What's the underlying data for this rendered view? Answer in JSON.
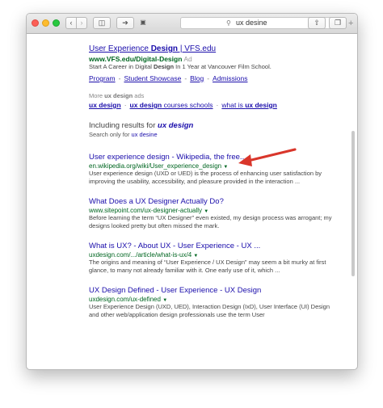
{
  "browser": {
    "address": "ux desine"
  },
  "ad": {
    "title_pre": "User Experience ",
    "title_bold": "Design",
    "title_post": " | VFS.edu",
    "url_pre": "www.VFS.edu/Digital-",
    "url_bold": "Design",
    "ad_tag": "Ad",
    "snippet_pre": "Start A Career in Digital ",
    "snippet_bold": "Design",
    "snippet_post": " In 1 Year at Vancouver Film School.",
    "sitelinks": [
      "Program",
      "Student Showcase",
      "Blog",
      "Admissions"
    ],
    "separator": "-"
  },
  "more_ads": {
    "label_pre": "More ",
    "label_bold": "ux design",
    "label_post": " ads",
    "links": [
      {
        "bold": "ux design",
        "rest": ""
      },
      {
        "bold": "ux design",
        "rest": " courses schools"
      },
      {
        "bold": "ux design",
        "rest": "what is ",
        "order": "rest-first"
      }
    ],
    "sep": "·"
  },
  "spell": {
    "including_pre": "Including results for ",
    "including_term": "ux design",
    "search_only_pre": "Search only for ",
    "search_only_term": "ux desine"
  },
  "results": [
    {
      "title": "User experience design - Wikipedia, the free...",
      "url": "en.wikipedia.org/wiki/User_experience_design",
      "snippet": "User experience design (UXD or UED) is the process of enhancing user satisfaction by improving the usability, accessibility, and pleasure provided in the interaction ..."
    },
    {
      "title": "What Does a UX Designer Actually Do?",
      "url": "www.sitepoint.com/ux-designer-actually",
      "snippet": "Before learning the term “UX Designer” even existed, my design process was arrogant; my designs looked pretty but often missed the mark."
    },
    {
      "title": "What is UX? - About UX - User Experience - UX ...",
      "url": "uxdesign.com/.../article/what-is-ux/4",
      "snippet": "The origins and meaning of “User Experience / UX Design” may seem a bit murky at first glance, to many not already familiar with it. One early use of it, which ..."
    },
    {
      "title": "UX Design Defined - User Experience - UX Design",
      "url": "uxdesign.com/ux-defined",
      "snippet": "User Experience Design (UXD, UED), Interaction Design (IxD), User Interface (UI) Design and other web/application design professionals use the term User"
    }
  ],
  "colors": {
    "link": "#1a0dab",
    "url": "#006621",
    "annotation_arrow": "#d9362b"
  },
  "icons": [
    "close-icon",
    "minimize-icon",
    "zoom-icon",
    "back-icon",
    "forward-icon",
    "sidebar-icon",
    "share-icon",
    "shield-icon",
    "search-icon",
    "upload-icon",
    "tabs-icon",
    "plus-icon",
    "caret-down-icon",
    "arrow-annotation-icon"
  ]
}
